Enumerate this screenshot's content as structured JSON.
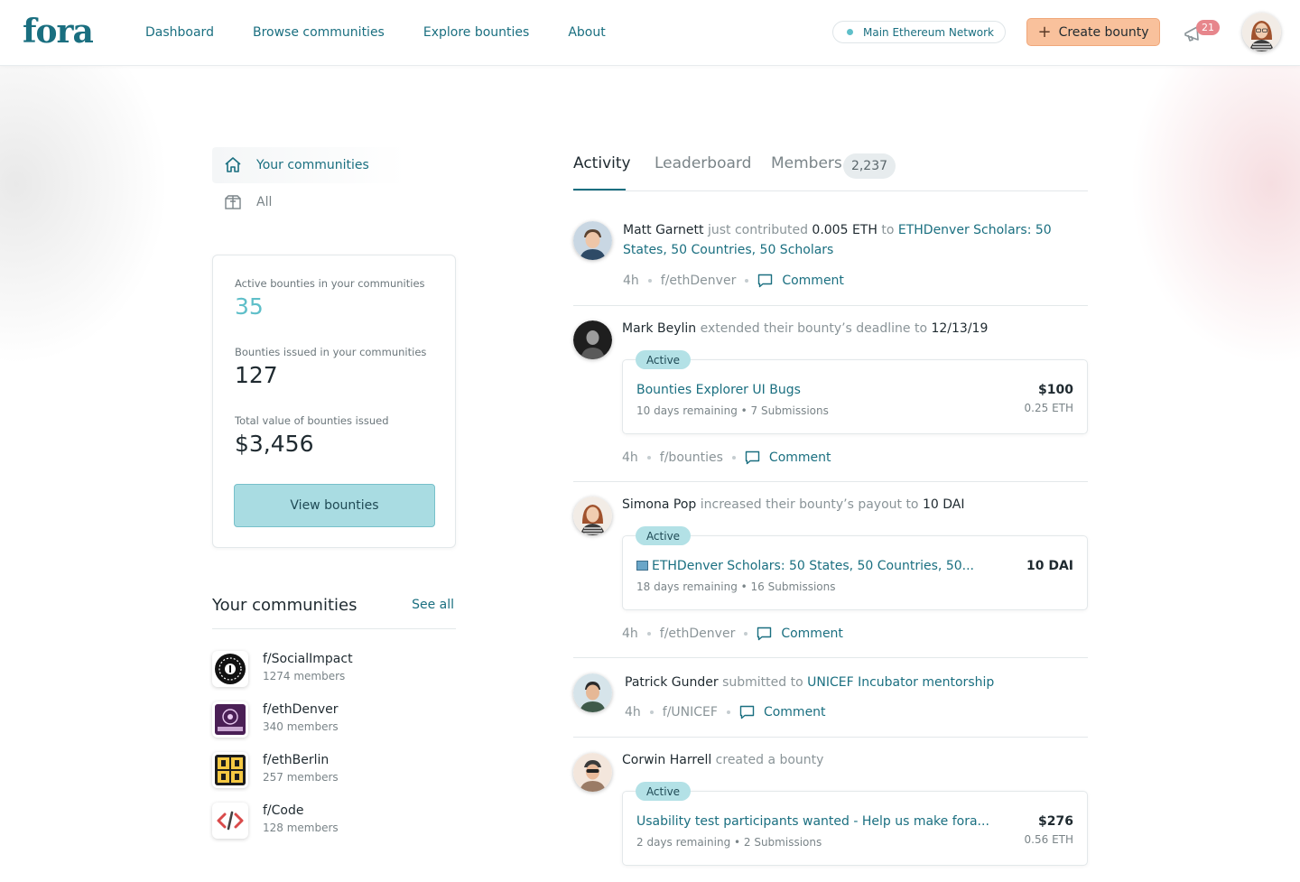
{
  "header": {
    "logo": "fora",
    "nav": [
      "Dashboard",
      "Browse communities",
      "Explore bounties",
      "About"
    ],
    "network": "Main Ethereum Network",
    "create_bounty": "Create bounty",
    "notification_count": "21"
  },
  "sidebar": {
    "your_communities": "Your communities",
    "all": "All"
  },
  "stats": {
    "active_label": "Active bounties in your communities",
    "active_value": "35",
    "issued_label": "Bounties issued in your communities",
    "issued_value": "127",
    "total_label": "Total value of bounties issued",
    "total_value": "$3,456",
    "view_button": "View bounties"
  },
  "communities": {
    "title": "Your communities",
    "see_all": "See all",
    "items": [
      {
        "name": "f/SocialImpact",
        "members": "1274 members"
      },
      {
        "name": "f/ethDenver",
        "members": "340 members"
      },
      {
        "name": "f/ethBerlin",
        "members": "257 members"
      },
      {
        "name": "f/Code",
        "members": "128 members"
      }
    ]
  },
  "tabs": {
    "activity": "Activity",
    "leaderboard": "Leaderboard",
    "members": "Members",
    "members_count": "2,237"
  },
  "feed": [
    {
      "who": "Matt Garnett",
      "action": " just contributed ",
      "amount": "0.005 ETH",
      "to": " to ",
      "target": "ETHDenver Scholars: 50 States, 50 Countries, 50 Scholars",
      "time": "4h",
      "community": "f/ethDenver",
      "comment": "Comment"
    },
    {
      "who": "Mark Beylin",
      "action": " extended their bounty’s deadline to ",
      "value": "12/13/19",
      "status": "Active",
      "bounty_title": "Bounties Explorer UI Bugs",
      "bounty_sub": "10 days remaining • 7 Submissions",
      "bounty_amount": "$100",
      "bounty_eth": "0.25 ETH",
      "time": "4h",
      "community": "f/bounties",
      "comment": "Comment"
    },
    {
      "who": "Simona Pop",
      "action": " increased their bounty’s payout to ",
      "value": "10 DAI",
      "status": "Active",
      "bounty_title": "ETHDenver Scholars: 50 States, 50 Countries, 50...",
      "bounty_sub": "18 days remaining • 16 Submissions",
      "bounty_amount": "10 DAI",
      "time": "4h",
      "community": "f/ethDenver",
      "comment": "Comment"
    },
    {
      "who": "Patrick Gunder",
      "action": " submitted to ",
      "target": "UNICEF Incubator mentorship",
      "time": "4h",
      "community": "f/UNICEF",
      "comment": "Comment"
    },
    {
      "who": "Corwin Harrell",
      "action": " created a bounty",
      "status": "Active",
      "bounty_title": "Usability test participants wanted - Help us make fora...",
      "bounty_sub": "2 days remaining • 2 Submissions",
      "bounty_amount": "$276",
      "bounty_eth": "0.56 ETH"
    }
  ],
  "colors": {
    "brand_teal": "#1a6f80",
    "accent_light_teal": "#5fbfc9",
    "create_button": "#f9c19c",
    "notification_badge": "#e7868c"
  }
}
